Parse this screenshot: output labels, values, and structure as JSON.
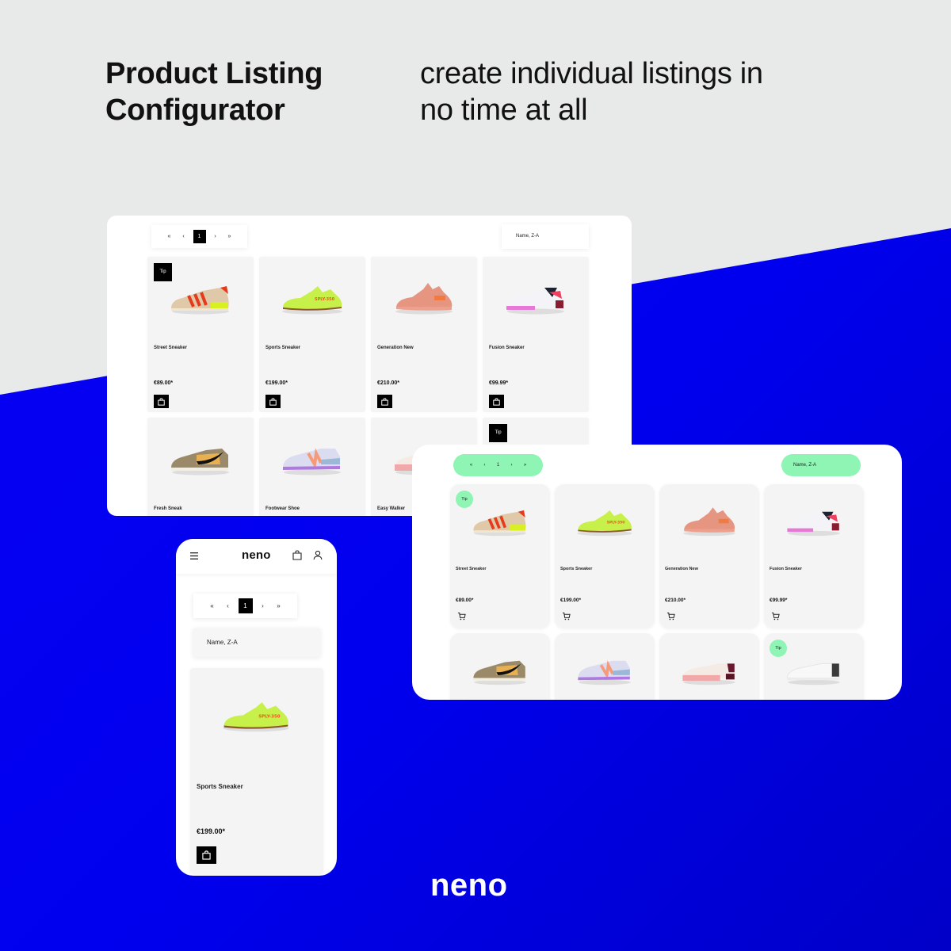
{
  "hero": {
    "title_line1": "Product Listing",
    "title_line2": "Configurator",
    "tagline_line1": "create individual listings in",
    "tagline_line2": "no time at all"
  },
  "colors": {
    "brand_blue": "#0000ee",
    "accent_green": "#8ef5b4",
    "black": "#000000",
    "card_bg": "#f4f4f4"
  },
  "pagination": {
    "first": "«",
    "prev": "‹",
    "current": "1",
    "next": "›",
    "last": "»"
  },
  "sort": {
    "selected": "Name, Z-A"
  },
  "tip_label": "Tip",
  "products": [
    {
      "name": "Street Sneaker",
      "price": "€89.00*",
      "tip": true,
      "image": "street-sneaker-shoe"
    },
    {
      "name": "Sports Sneaker",
      "price": "€199.00*",
      "tip": false,
      "image": "sports-sneaker-shoe"
    },
    {
      "name": "Generation New",
      "price": "€210.00*",
      "tip": false,
      "image": "generation-new-shoe"
    },
    {
      "name": "Fusion Sneaker",
      "price": "€99.99*",
      "tip": false,
      "image": "fusion-sneaker-shoe"
    },
    {
      "name": "Fresh Sneak",
      "price": "",
      "tip": false,
      "image": "fresh-sneak-shoe"
    },
    {
      "name": "Footwear Shoe",
      "price": "",
      "tip": false,
      "image": "footwear-shoe"
    },
    {
      "name": "Easy Walker",
      "price": "",
      "tip": false,
      "image": "easy-walker-shoe"
    },
    {
      "name": "",
      "price": "",
      "tip": true,
      "image": "white-sneaker-shoe"
    }
  ],
  "mobile": {
    "logo": "neno",
    "product": {
      "name": "Sports Sneaker",
      "price": "€199.00*"
    }
  },
  "footer": {
    "brand": "neno"
  }
}
